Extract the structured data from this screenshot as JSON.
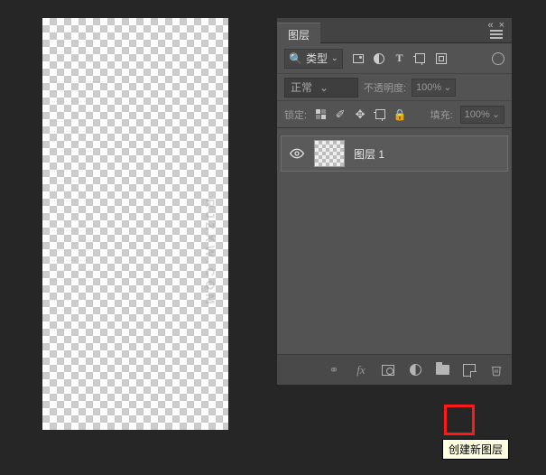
{
  "panel": {
    "tab_label": "图层",
    "filter_label": "类型",
    "search_glyph": "🔍",
    "blend_mode": "正常",
    "opacity_label": "不透明度:",
    "opacity_value": "100%",
    "lock_label": "锁定:",
    "fill_label": "填充:",
    "fill_value": "100%"
  },
  "layers": [
    {
      "name": "图层 1"
    }
  ],
  "tooltip": {
    "new_layer": "创建新图层"
  },
  "watermark": "RJZXW.COM",
  "icons": {
    "image": "image-icon",
    "adjust": "adjustment-icon",
    "text": "T",
    "shape": "shape-icon",
    "smart": "smart-icon",
    "link": "⧉",
    "fx": "fx",
    "mask": "mask-icon",
    "folder": "folder-icon",
    "new": "new-icon",
    "trash": "trash-icon"
  }
}
